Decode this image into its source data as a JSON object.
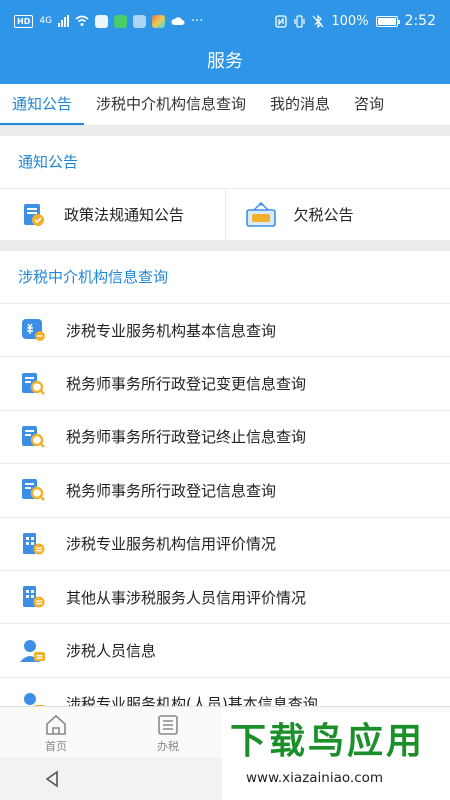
{
  "status_bar": {
    "hd": "HD",
    "net": "4G",
    "battery": "100%",
    "time": "2:52"
  },
  "title": "服务",
  "tabs": [
    {
      "label": "通知公告"
    },
    {
      "label": "涉税中介机构信息查询"
    },
    {
      "label": "我的消息"
    },
    {
      "label": "咨询"
    }
  ],
  "notice_section": {
    "title": "通知公告",
    "items": [
      {
        "label": "政策法规通知公告",
        "icon": "policy-doc-icon"
      },
      {
        "label": "欠税公告",
        "icon": "tax-owed-sign-icon"
      }
    ]
  },
  "agency_section": {
    "title": "涉税中介机构信息查询",
    "items": [
      {
        "label": "涉税专业服务机构基本信息查询",
        "icon": "agency-badge-icon"
      },
      {
        "label": "税务师事务所行政登记变更信息查询",
        "icon": "doc-search-icon"
      },
      {
        "label": "税务师事务所行政登记终止信息查询",
        "icon": "doc-search-icon"
      },
      {
        "label": "税务师事务所行政登记信息查询",
        "icon": "doc-search-icon"
      },
      {
        "label": "涉税专业服务机构信用评价情况",
        "icon": "building-icon"
      },
      {
        "label": "其他从事涉税服务人员信用评价情况",
        "icon": "building-icon"
      },
      {
        "label": "涉税人员信息",
        "icon": "person-icon"
      },
      {
        "label": "涉税专业服务机构(人员)基本信息查询",
        "icon": "person-icon"
      }
    ]
  },
  "bottom_nav": [
    {
      "label": "首页",
      "icon": "home-icon"
    },
    {
      "label": "办税",
      "icon": "list-icon"
    }
  ],
  "watermark": {
    "main": "下载鸟应用",
    "sub": "www.xiazainiao.com"
  },
  "colors": {
    "brand": "#2f95e7",
    "accent_text": "#1f86d8",
    "icon_blue": "#3d8fe6",
    "icon_yellow": "#f2b12c",
    "watermark_green": "#1b8f2a"
  }
}
